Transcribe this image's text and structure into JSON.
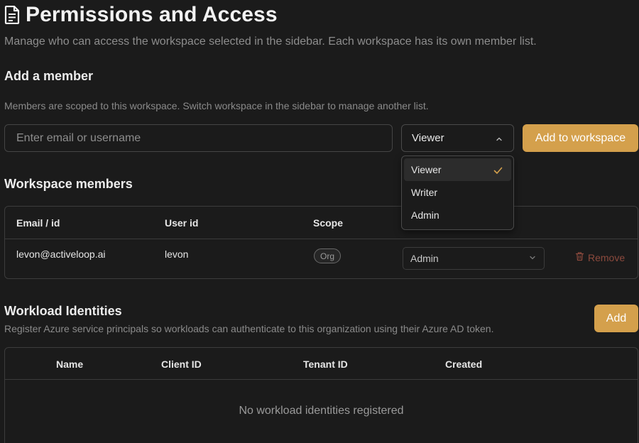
{
  "header": {
    "title": "Permissions and Access",
    "subtitle": "Manage who can access the workspace selected in the sidebar. Each workspace has its own member list.",
    "icon": "document-icon"
  },
  "add_member": {
    "heading": "Add a member",
    "note": "Members are scoped to this workspace. Switch workspace in the sidebar to manage another list.",
    "input_placeholder": "Enter email or username",
    "input_value": "",
    "role_selected": "Viewer",
    "submit_label": "Add to workspace",
    "role_options": [
      "Viewer",
      "Writer",
      "Admin"
    ]
  },
  "members": {
    "heading": "Workspace members",
    "columns": [
      "Email / id",
      "User id",
      "Scope"
    ],
    "rows": [
      {
        "email": "levon@activeloop.ai",
        "user_id": "levon",
        "scope": "Org",
        "role": "Admin",
        "remove_label": "Remove"
      }
    ]
  },
  "workload": {
    "heading": "Workload Identities",
    "description": "Register Azure service principals so workloads can authenticate to this organization using their Azure AD token.",
    "add_label": "Add",
    "columns": [
      "Name",
      "Client ID",
      "Tenant ID",
      "Created"
    ],
    "empty_text": "No workload identities registered"
  },
  "colors": {
    "background": "#1b1b1b",
    "accent": "#d4a04c",
    "danger": "#8c4a3d",
    "border": "#3c3c3c"
  }
}
